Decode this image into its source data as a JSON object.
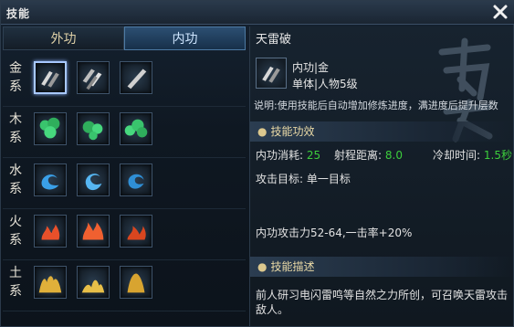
{
  "window": {
    "title": "技能"
  },
  "tabs": [
    {
      "label": "外功",
      "active": false
    },
    {
      "label": "内功",
      "active": true
    }
  ],
  "rows": [
    {
      "label": [
        "金",
        "系"
      ],
      "element": "metal",
      "color": "#cfcfcf",
      "icons": [
        "metal-skill-1-icon",
        "metal-skill-2-icon",
        "metal-skill-3-icon"
      ]
    },
    {
      "label": [
        "木",
        "系"
      ],
      "element": "wood",
      "color": "#38c86a",
      "icons": [
        "wood-skill-1-icon",
        "wood-skill-2-icon",
        "wood-skill-3-icon"
      ]
    },
    {
      "label": [
        "水",
        "系"
      ],
      "element": "water",
      "color": "#3aa0e8",
      "icons": [
        "water-skill-1-icon",
        "water-skill-2-icon",
        "water-skill-3-icon"
      ]
    },
    {
      "label": [
        "火",
        "系"
      ],
      "element": "fire",
      "color": "#e8502a",
      "icons": [
        "fire-skill-1-icon",
        "fire-skill-2-icon",
        "fire-skill-3-icon"
      ]
    },
    {
      "label": [
        "土",
        "系"
      ],
      "element": "earth",
      "color": "#e0b03a",
      "icons": [
        "earth-skill-1-icon",
        "earth-skill-2-icon",
        "earth-skill-3-icon"
      ]
    }
  ],
  "selected_skill": {
    "name": "天雷破",
    "type_line": "内功|金",
    "target_line": "单体|人物5级",
    "description": "说明:使用技能后自动增加修炼进度，满进度后提升层数",
    "section_effect": "技能功效",
    "stats": {
      "cost_label": "内功消耗:",
      "cost_value": "25",
      "range_label": "射程距离:",
      "range_value": "8.0",
      "cooldown_label": "冷却时间:",
      "cooldown_value": "1.5秒"
    },
    "attack_target": "攻击目标:  单一目标",
    "power": "内功攻击力52-64,一击率+20%",
    "section_desc": "技能描述",
    "lore": "前人研习电闪雷鸣等自然之力所创，可召唤天雷攻击敌人。"
  },
  "colors": {
    "accent": "#4d7aa3",
    "stat_value": "#3ccd3c",
    "section_text": "#e9d9a6"
  }
}
